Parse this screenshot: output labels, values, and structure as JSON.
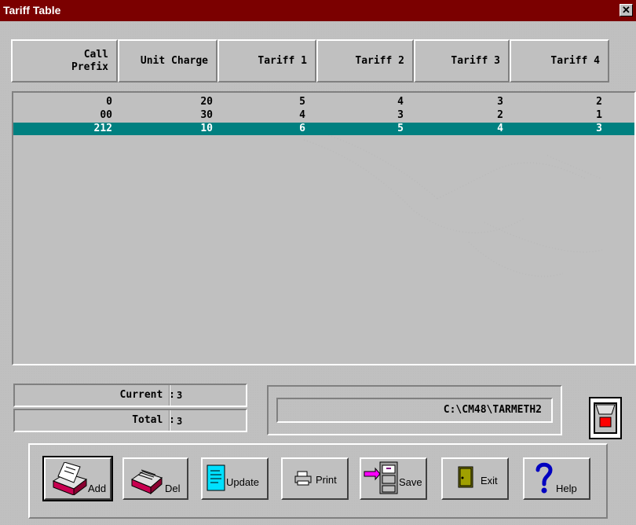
{
  "window": {
    "title": "Tariff Table",
    "close_label": "✕"
  },
  "columns": [
    "Call\nPrefix",
    "Unit Charge",
    "Tariff 1",
    "Tariff 2",
    "Tariff 3",
    "Tariff 4"
  ],
  "rows": [
    [
      "0",
      "20",
      "5",
      "4",
      "3",
      "2"
    ],
    [
      "00",
      "30",
      "4",
      "3",
      "2",
      "1"
    ],
    [
      "212",
      "10",
      "6",
      "5",
      "4",
      "3"
    ]
  ],
  "selected_row": 2,
  "info": {
    "current_label": "Current :",
    "current_value": "3",
    "total_label": "Total :",
    "total_value": "3"
  },
  "path": "C:\\CM48\\TARMETH2",
  "buttons": {
    "add": "Add",
    "del": "Del",
    "update": "Update",
    "print": "Print",
    "save": "Save",
    "exit": "Exit",
    "help": "Help"
  },
  "colors": {
    "titlebar": "#7b0000",
    "selection": "#008080",
    "face": "#c0c0c0"
  }
}
